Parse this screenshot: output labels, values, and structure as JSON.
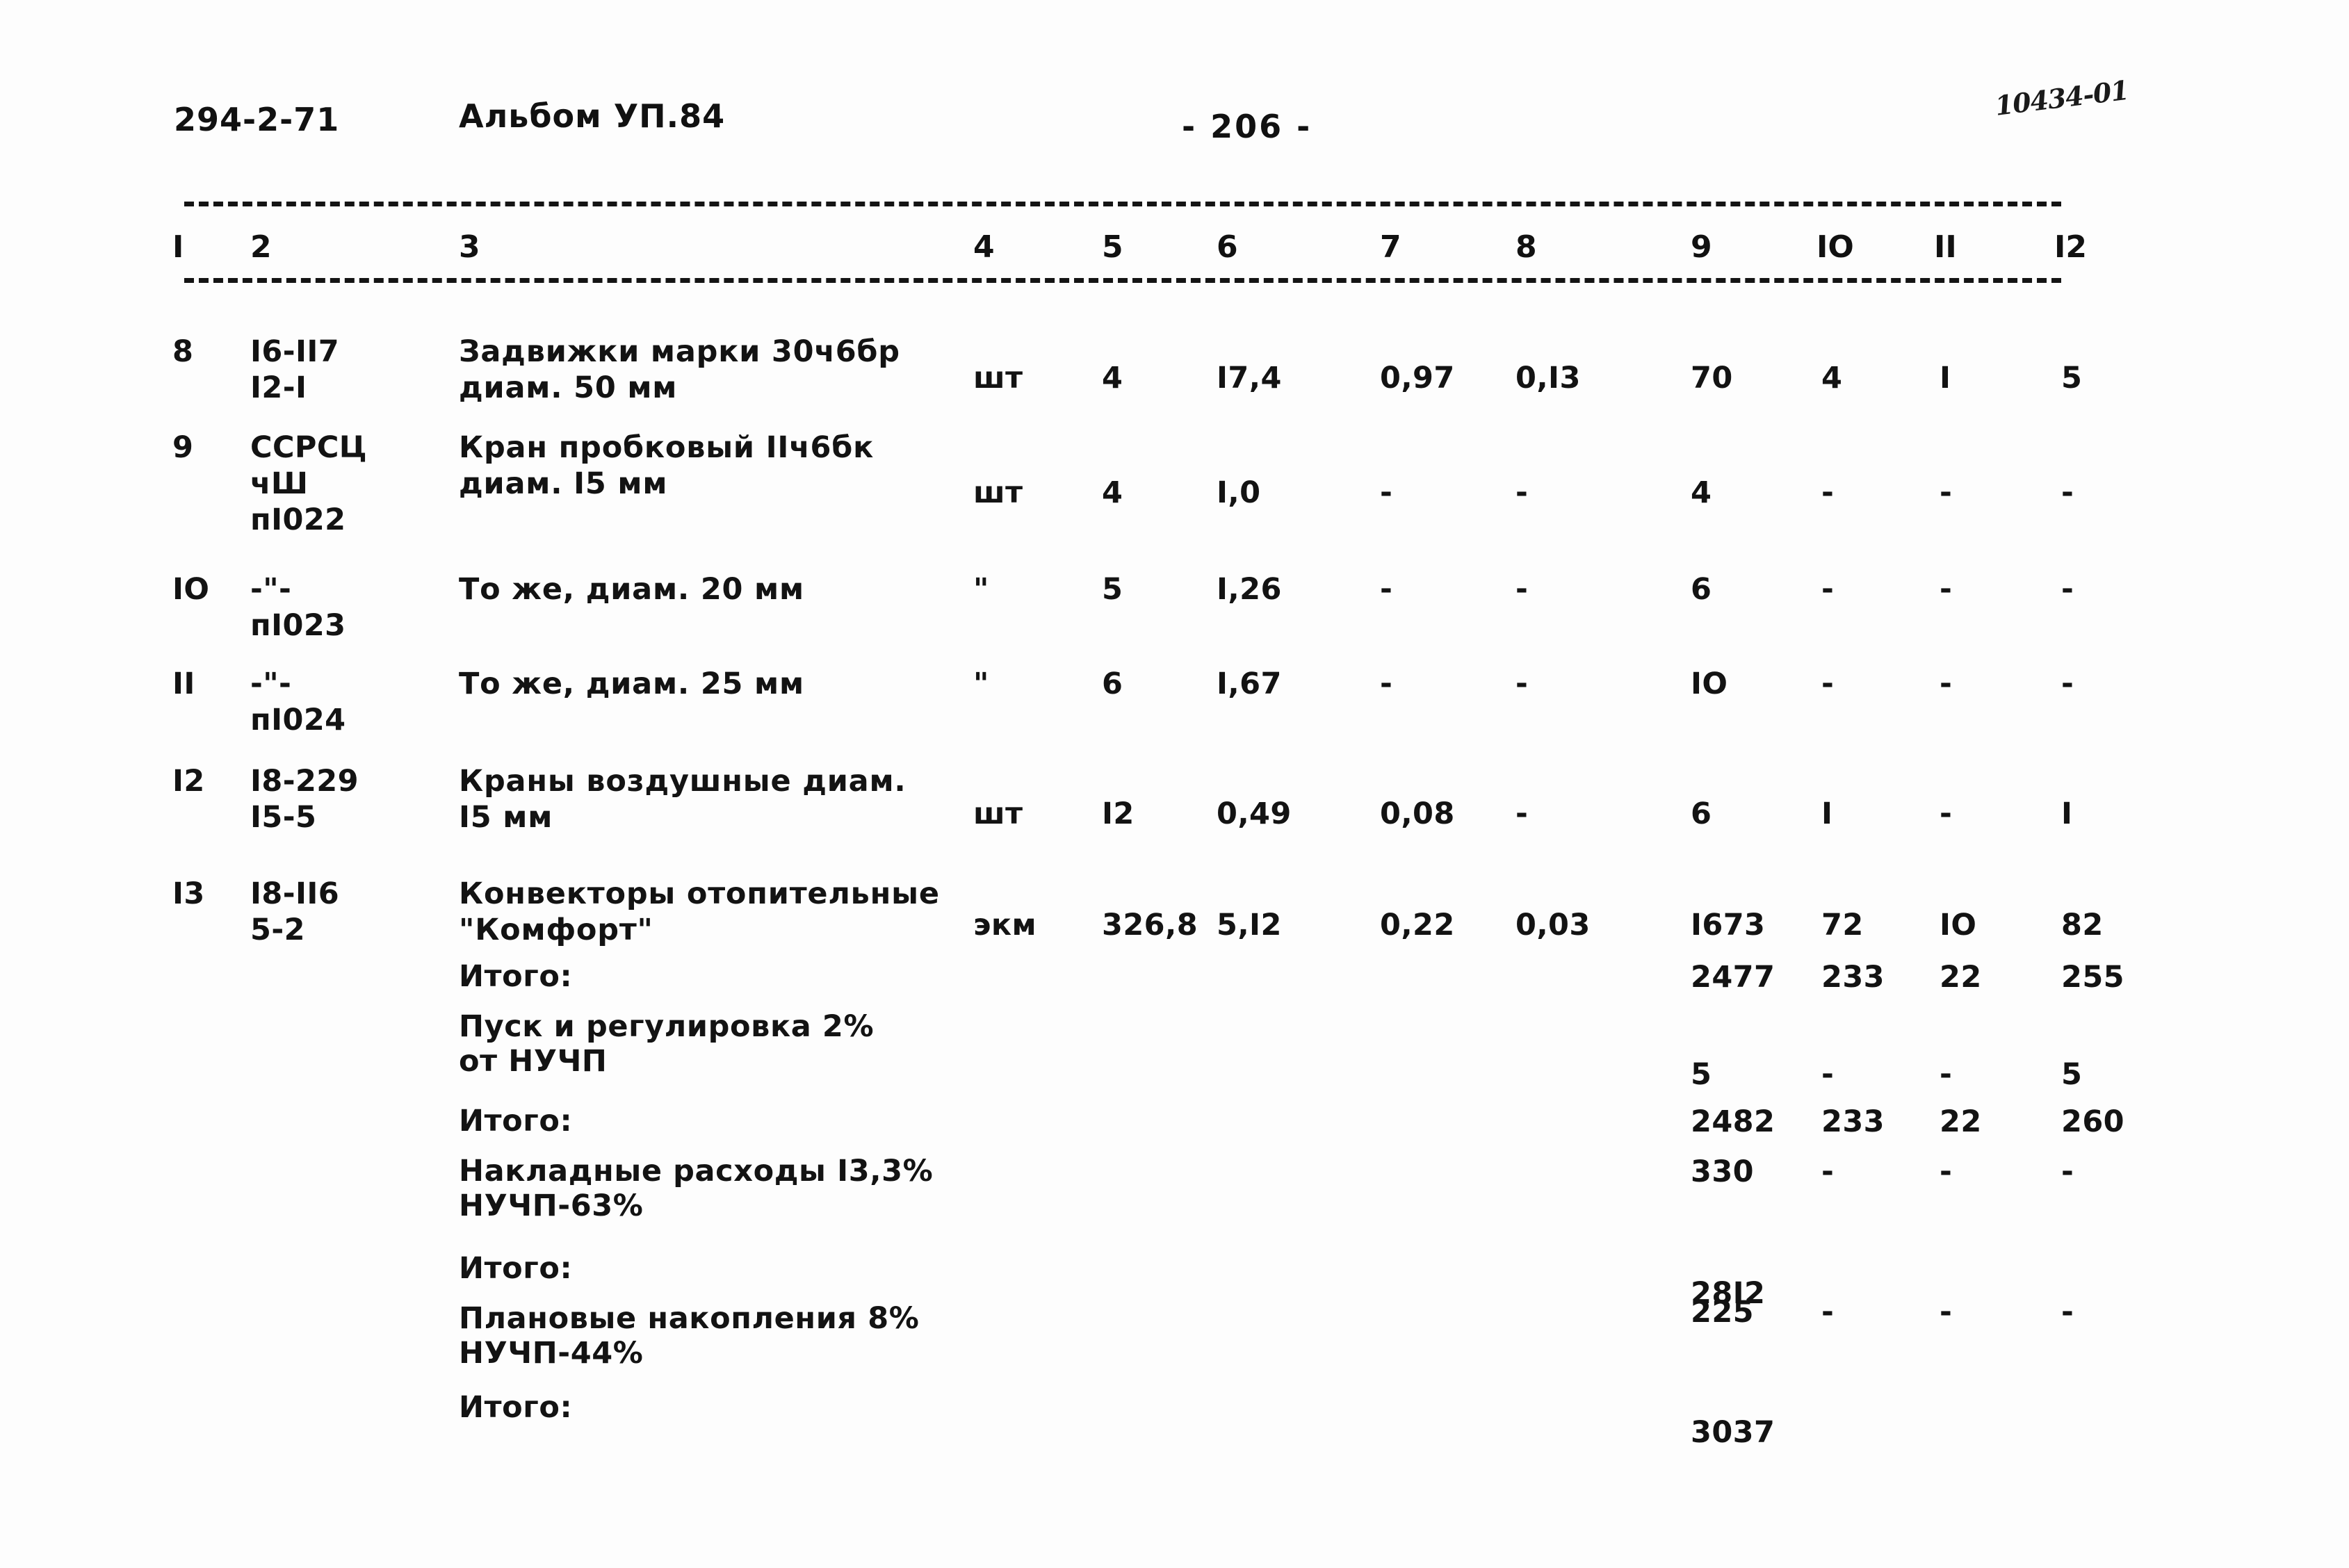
{
  "header": {
    "doc_code": "294-2-71",
    "album": "Альбом УП.84",
    "page_number": "- 206 -",
    "hand_note": "10434-01"
  },
  "table": {
    "column_numbers": [
      "I",
      "2",
      "3",
      "4",
      "5",
      "6",
      "7",
      "8",
      "9",
      "IO",
      "II",
      "I2"
    ],
    "rows": [
      {
        "no": "8",
        "code": "I6-II7\nI2-I",
        "description": "Задвижки марки 30ч6бр\nдиам. 50 мм",
        "unit": "шт",
        "c5": "4",
        "c6": "I7,4",
        "c7": "0,97",
        "c8": "0,I3",
        "c9": "70",
        "c10": "4",
        "c11": "I",
        "c12": "5"
      },
      {
        "no": "9",
        "code": "ССРСЦ\nчШ\nпI022",
        "description": "Кран пробковый IIч6бк\nдиам. I5 мм",
        "unit": "шт",
        "c5": "4",
        "c6": "I,0",
        "c7": "-",
        "c8": "-",
        "c9": "4",
        "c10": "-",
        "c11": "-",
        "c12": "-"
      },
      {
        "no": "IO",
        "code": "-\"-\nпI023",
        "description": "То же, диам. 20 мм",
        "unit": "\"",
        "c5": "5",
        "c6": "I,26",
        "c7": "-",
        "c8": "-",
        "c9": "6",
        "c10": "-",
        "c11": "-",
        "c12": "-"
      },
      {
        "no": "II",
        "code": "-\"-\nпI024",
        "description": "То же, диам. 25 мм",
        "unit": "\"",
        "c5": "6",
        "c6": "I,67",
        "c7": "-",
        "c8": "-",
        "c9": "IO",
        "c10": "-",
        "c11": "-",
        "c12": "-"
      },
      {
        "no": "I2",
        "code": "I8-229\nI5-5",
        "description": "Краны воздушные диам.\nI5 мм",
        "unit": "шт",
        "c5": "I2",
        "c6": "0,49",
        "c7": "0,08",
        "c8": "-",
        "c9": "6",
        "c10": "I",
        "c11": "-",
        "c12": "I"
      },
      {
        "no": "I3",
        "code": "I8-II6\n5-2",
        "description": "Конвекторы отопительные\n\"Комфорт\"",
        "unit": "экм",
        "c5": "326,8",
        "c6": "5,I2",
        "c7": "0,22",
        "c8": "0,03",
        "c9": "I673",
        "c10": "72",
        "c11": "IO",
        "c12": "82"
      }
    ],
    "summary": [
      {
        "label": "Итого:",
        "c9": "2477",
        "c10": "233",
        "c11": "22",
        "c12": "255"
      },
      {
        "label": "Пуск и регулировка 2%\nот НУЧП",
        "c9": "5",
        "c10": "-",
        "c11": "-",
        "c12": "5"
      },
      {
        "label": "Итого:",
        "c9": "2482",
        "c10": "233",
        "c11": "22",
        "c12": "260"
      },
      {
        "label": "Накладные расходы I3,3%\nНУЧП-63%",
        "c9": "330",
        "c10": "-",
        "c11": "-",
        "c12": "-"
      },
      {
        "label": "Итого:",
        "c9": "28I2",
        "c10": "",
        "c11": "",
        "c12": ""
      },
      {
        "label": "Плановые накопления 8%\nНУЧП-44%",
        "c9": "225",
        "c10": "-",
        "c11": "-",
        "c12": "-"
      },
      {
        "label": "Итого:",
        "c9": "3037",
        "c10": "",
        "c11": "",
        "c12": ""
      }
    ]
  }
}
